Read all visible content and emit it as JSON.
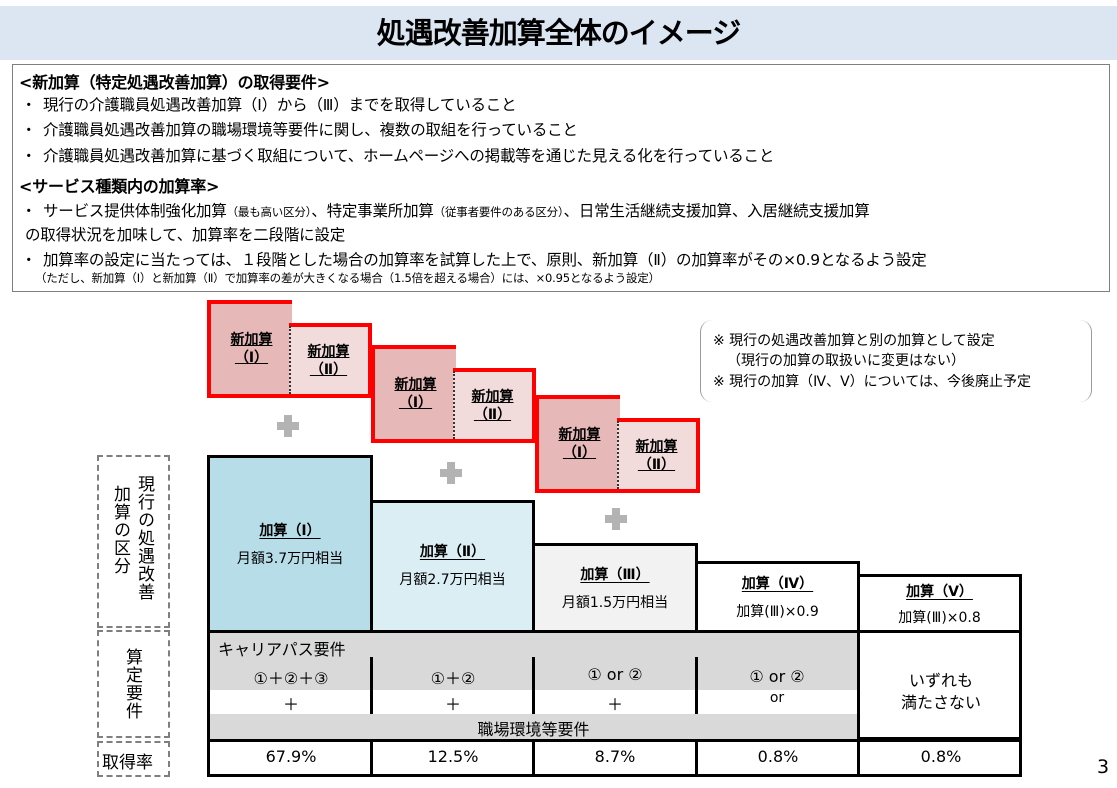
{
  "title": "処遇改善加算全体のイメージ",
  "requirements_box": {
    "heading1": "<新加算（特定処遇改善加算）の取得要件>",
    "items1": [
      "現行の介護職員処遇改善加算（Ⅰ）から（Ⅲ）までを取得していること",
      "介護職員処遇改善加算の職場環境等要件に関し、複数の取組を行っていること",
      "介護職員処遇改善加算に基づく取組について、ホームページへの掲載等を通じた見える化を行っていること"
    ],
    "heading2": "<サービス種類内の加算率>",
    "item2a_part1": "サービス提供体制強化加算",
    "item2a_small1": "（最も高い区分）",
    "item2a_part2": "、特定事業所加算",
    "item2a_small2": "（従事者要件のある区分）",
    "item2a_part3": "、日常生活継続支援加算、入居継続支援加算",
    "item2a_line2": "の取得状況を加味して、加算率を二段階に設定",
    "item2b": "加算率の設定に当たっては、１段階とした場合の加算率を試算した上で、原則、新加算（Ⅱ）の加算率がその×0.9となるよう設定",
    "item2b_note": "（ただし、新加算（Ⅰ）と新加算（Ⅱ）で加算率の差が大きくなる場合（1.5倍を超える場合）には、×0.95となるよう設定）",
    "bullet": "・"
  },
  "new_additions": {
    "label": "新加算",
    "level_I": "（Ⅰ）",
    "level_II": "（Ⅱ）",
    "colors": {
      "border": "#ff0000",
      "level_I_fill": "#e6b8b7",
      "level_II_fill": "#f2dcdb"
    }
  },
  "notes": [
    "※  現行の処遇改善加算と別の加算として設定",
    "（現行の加算の取扱いに変更はない）",
    "※  現行の加算（Ⅳ、Ⅴ）については、今後廃止予定"
  ],
  "side_labels": {
    "current_category": [
      "現行の処遇改善",
      "加算の区分"
    ],
    "calc_requirements": "算定要件",
    "acquisition_rate": "取得率"
  },
  "current_additions": [
    {
      "title": "加算（Ⅰ）",
      "subtitle": "月額3.7万円相当",
      "color": "#b7dde8"
    },
    {
      "title": "加算（Ⅱ）",
      "subtitle": "月額2.7万円相当",
      "color": "#dbeef4"
    },
    {
      "title": "加算（Ⅲ）",
      "subtitle": "月額1.5万円相当",
      "color": "#f2f2f2"
    },
    {
      "title": "加算（Ⅳ）",
      "subtitle": "加算(Ⅲ)×0.9",
      "color": "#ffffff"
    },
    {
      "title": "加算（Ⅴ）",
      "subtitle": "加算(Ⅲ)×0.8",
      "color": "#ffffff"
    }
  ],
  "requirements_table": {
    "career_path_label": "キャリアパス要件",
    "workplace_label": "職場環境等要件",
    "career": [
      "①＋②＋③",
      "①＋②",
      "① or ②",
      "① or ②"
    ],
    "connectors": [
      "＋",
      "＋",
      "＋",
      "or"
    ],
    "none_line1": "いずれも",
    "none_line2": "満たさない"
  },
  "rates": [
    "67.9%",
    "12.5%",
    "8.7%",
    "0.8%",
    "0.8%"
  ],
  "page_number": "3"
}
